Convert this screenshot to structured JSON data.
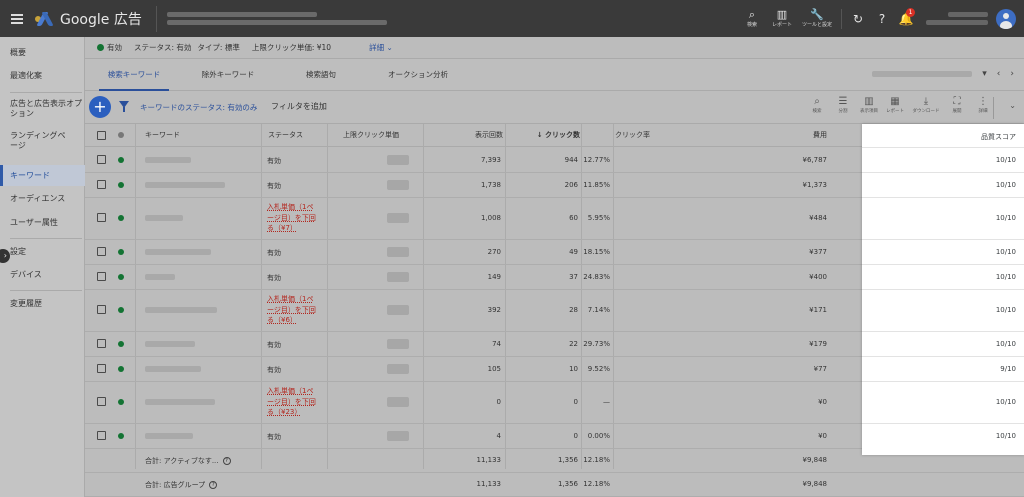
{
  "topbar": {
    "brand": "Google 広告",
    "buttons": [
      {
        "icon": "search-icon",
        "label": "検索"
      },
      {
        "icon": "report-icon",
        "label": "レポート"
      },
      {
        "icon": "wrench-icon",
        "label": "ツールと設定"
      }
    ],
    "notification_count": "1"
  },
  "sidenav": {
    "items": [
      "概要",
      "最適化案",
      "広告と広告表示オプション",
      "ランディングページ",
      "キーワード",
      "オーディエンス",
      "ユーザー属性",
      "設定",
      "デバイス",
      "変更履歴"
    ],
    "active": "キーワード"
  },
  "statusbar": {
    "state": "有効",
    "status": "ステータス: 有効",
    "type": "タイプ: 標準",
    "max_cpc": "上限クリック単価: ¥10",
    "details": "詳細"
  },
  "tabs": [
    "検索キーワード",
    "除外キーワード",
    "検索語句",
    "オークション分析"
  ],
  "toolbar": {
    "filter_label": "キーワードのステータス: 有効のみ",
    "add_filter": "フィルタを追加",
    "tools": [
      {
        "icon": "search-icon",
        "label": "検索"
      },
      {
        "icon": "segment-icon",
        "label": "分割"
      },
      {
        "icon": "columns-icon",
        "label": "表示項目"
      },
      {
        "icon": "chart-icon",
        "label": "レポート"
      },
      {
        "icon": "download-icon",
        "label": "ダウンロード"
      },
      {
        "icon": "expand-icon",
        "label": "展開"
      },
      {
        "icon": "more-icon",
        "label": "詳細"
      }
    ]
  },
  "table": {
    "headers": {
      "keyword": "キーワード",
      "status": "ステータス",
      "max_cpc": "上限クリック単価",
      "impressions": "表示回数",
      "clicks": "↓ クリック数",
      "ctr": "クリック率",
      "cost": "費用",
      "quality": "品質スコア"
    },
    "rows": [
      {
        "status": "有効",
        "impr": "7,393",
        "clicks": "944",
        "ctr": "12.77%",
        "cost": "¥6,787",
        "qs": "10/10"
      },
      {
        "status": "有効",
        "impr": "1,738",
        "clicks": "206",
        "ctr": "11.85%",
        "cost": "¥1,373",
        "qs": "10/10"
      },
      {
        "status": "入札単価（1ページ目）を下回る（¥7）",
        "status_lines": [
          "入札単価（1ペ",
          "ージ目）を下回",
          "る（¥7）"
        ],
        "impr": "1,008",
        "clicks": "60",
        "ctr": "5.95%",
        "cost": "¥484",
        "qs": "10/10"
      },
      {
        "status": "有効",
        "impr": "270",
        "clicks": "49",
        "ctr": "18.15%",
        "cost": "¥377",
        "qs": "10/10"
      },
      {
        "status": "有効",
        "impr": "149",
        "clicks": "37",
        "ctr": "24.83%",
        "cost": "¥400",
        "qs": "10/10"
      },
      {
        "status": "入札単価（1ページ目）を下回る（¥6）",
        "status_lines": [
          "入札単価（1ペ",
          "ージ目）を下回",
          "る（¥6）"
        ],
        "impr": "392",
        "clicks": "28",
        "ctr": "7.14%",
        "cost": "¥171",
        "qs": "10/10"
      },
      {
        "status": "有効",
        "impr": "74",
        "clicks": "22",
        "ctr": "29.73%",
        "cost": "¥179",
        "qs": "10/10"
      },
      {
        "status": "有効",
        "impr": "105",
        "clicks": "10",
        "ctr": "9.52%",
        "cost": "¥77",
        "qs": "9/10"
      },
      {
        "status": "入札単価（1ページ目）を下回る（¥23）",
        "status_lines": [
          "入札単価（1ペ",
          "ージ目）を下回",
          "る（¥23）"
        ],
        "impr": "0",
        "clicks": "0",
        "ctr": "—",
        "cost": "¥0",
        "qs": "10/10"
      },
      {
        "status": "有効",
        "impr": "4",
        "clicks": "0",
        "ctr": "0.00%",
        "cost": "¥0",
        "qs": "10/10"
      }
    ],
    "totals": [
      {
        "label": "合計: アクティブなす...",
        "impr": "11,133",
        "clicks": "1,356",
        "ctr": "12.18%",
        "cost": "¥9,848"
      },
      {
        "label": "合計: 広告グループ",
        "impr": "11,133",
        "clicks": "1,356",
        "ctr": "12.18%",
        "cost": "¥9,848"
      }
    ]
  }
}
